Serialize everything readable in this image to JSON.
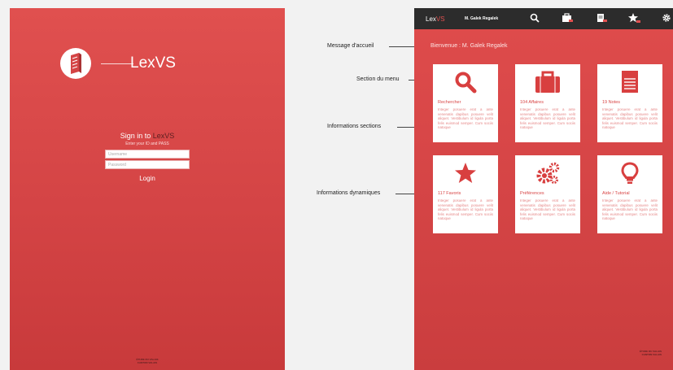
{
  "login": {
    "app_name": "LexVS",
    "signin_prefix": "Sign in to ",
    "signin_brand": "LexVS",
    "signin_subtitle": "Enter your ID and PASS",
    "username_placeholder": "Username",
    "password_placeholder": "Password",
    "login_label": "Login",
    "footer_line1": "ÉTUDE DU VALAIS",
    "footer_line2": "CANTON VALAIS"
  },
  "annotations": {
    "welcome": "Message d'accueil",
    "menu_section": "Section du menu",
    "section_info": "Informations sections",
    "dynamic_info": "Informations dynamiques"
  },
  "app": {
    "brand_lex": "Lex",
    "brand_vs": "VS",
    "user_name": "M. Galek Regalek",
    "welcome": "Bienvenue : M. Galek Regalek",
    "toolbar_icons": [
      "search-icon",
      "briefcase-icon",
      "notes-icon",
      "star-icon",
      "gear-icon"
    ],
    "accent_color": "#d44445",
    "cards": [
      {
        "title": "Rechercher",
        "icon": "search-icon",
        "text": "Integer posuere erat a ante venenatis dapibus posuere velit aliquet. Vestibulum id ligula porta felis euismod semper. Cum sociis natoque"
      },
      {
        "title": "104 Affaires",
        "icon": "briefcase-icon",
        "text": "Integer posuere erat a ante venenatis dapibus posuere velit aliquet. Vestibulum id ligula porta felis euismod semper. Cum sociis natoque"
      },
      {
        "title": "19 Notes",
        "icon": "notes-icon",
        "text": "Integer posuere erat a ante venenatis dapibus posuere velit aliquet. Vestibulum id ligula porta felis euismod semper. Cum sociis natoque"
      },
      {
        "title": "117 Favoris",
        "icon": "star-icon",
        "text": "Integer posuere erat a ante venenatis dapibus posuere velit aliquet. Vestibulum id ligula porta felis euismod semper. Cum sociis natoque"
      },
      {
        "title": "Préférences",
        "icon": "gears-icon",
        "text": "Integer posuere erat a ante venenatis dapibus posuere velit aliquet. Vestibulum id ligula porta felis euismod semper. Cum sociis natoque"
      },
      {
        "title": "Aide / Tutorial",
        "icon": "lightbulb-icon",
        "text": "Integer posuere erat a ante venenatis dapibus posuere velit aliquet. Vestibulum id ligula porta felis euismod semper. Cum sociis natoque"
      }
    ],
    "footer_line1": "ÉTUDE DU VALAIS",
    "footer_line2": "CANTON VALAIS"
  }
}
